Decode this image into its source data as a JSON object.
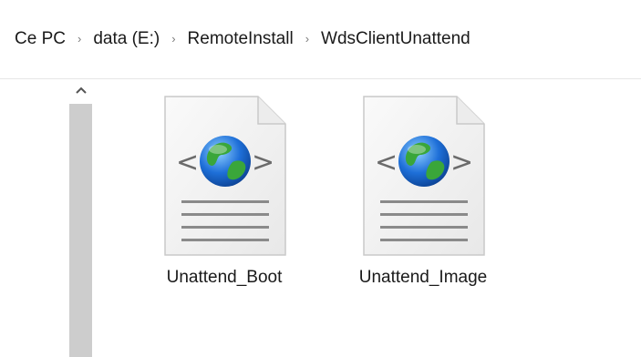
{
  "breadcrumb": {
    "items": [
      "Ce PC",
      "data (E:)",
      "RemoteInstall",
      "WdsClientUnattend"
    ],
    "separator": "›"
  },
  "scrollbar": {
    "up_arrow": "^"
  },
  "files": [
    {
      "name": "Unattend_Boot",
      "icon": "xml-file-globe-icon"
    },
    {
      "name": "Unattend_Image",
      "icon": "xml-file-globe-icon"
    }
  ],
  "colors": {
    "text": "#1a1a1a",
    "scroll_thumb": "#cdcdcd",
    "globe_blue": "#1e6fd8",
    "globe_green": "#3aa63a",
    "document_bg": "#f3f3f3"
  }
}
